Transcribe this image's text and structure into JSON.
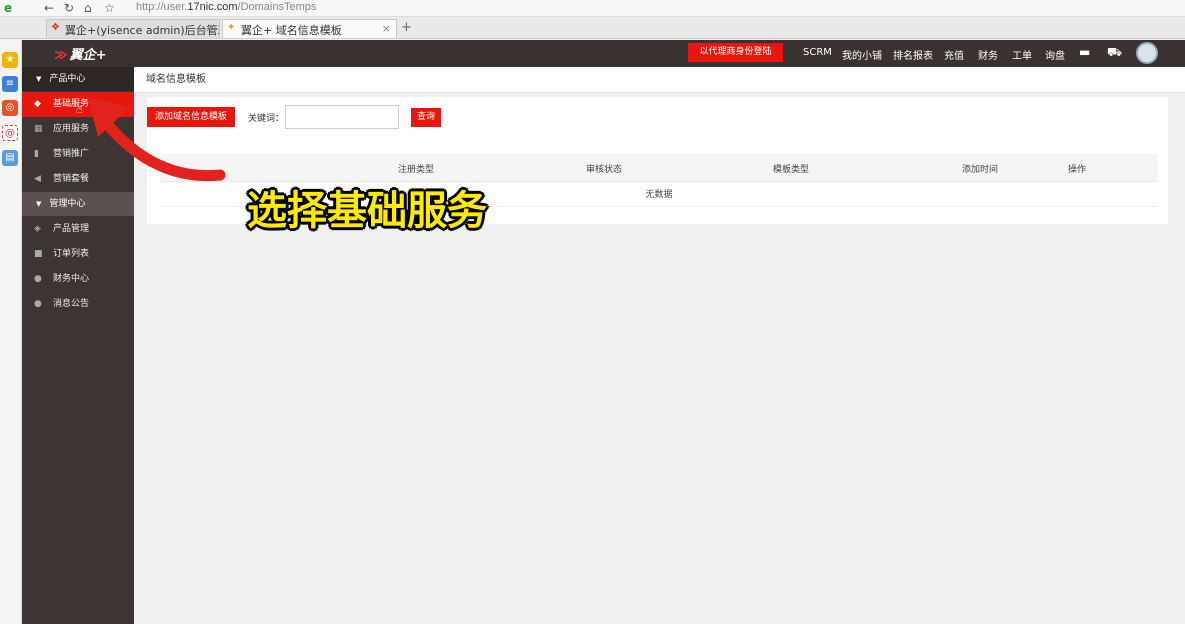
{
  "browser": {
    "url_prefix": "http://user.",
    "url_domain": "17nic.com",
    "url_path": "/DomainsTemps",
    "tabs": [
      {
        "label": "翼企+(yisence admin)后台管理"
      },
      {
        "label": "翼企+ 域名信息模板"
      }
    ],
    "new_tab": "+"
  },
  "topbar": {
    "logo": "翼企+",
    "proxy_button": "以代理商身份登陆",
    "nav": [
      "SCRM",
      "我的小铺",
      "排名报表",
      "充值",
      "财务",
      "工单",
      "询盘"
    ]
  },
  "sidebar": {
    "groups": [
      {
        "label": "产品中心"
      },
      {
        "label": "管理中心"
      }
    ],
    "items_product": [
      {
        "label": "基础服务",
        "icon": "layers-icon"
      },
      {
        "label": "应用服务",
        "icon": "building-icon"
      },
      {
        "label": "营销推广",
        "icon": "chart-icon"
      },
      {
        "label": "营销套餐",
        "icon": "megaphone-icon"
      }
    ],
    "items_manage": [
      {
        "label": "产品管理",
        "icon": "box-icon"
      },
      {
        "label": "订单列表",
        "icon": "lock-icon"
      },
      {
        "label": "财务中心",
        "icon": "money-bag-icon"
      },
      {
        "label": "消息公告",
        "icon": "message-icon"
      }
    ]
  },
  "main": {
    "breadcrumb": "域名信息模板",
    "add_button": "添加域名信息模板",
    "keyword_label": "关键词：",
    "keyword_value": "",
    "search_button": "查询",
    "table": {
      "headers": [
        "注册类型",
        "审核状态",
        "模板类型",
        "添加时间",
        "操作"
      ],
      "empty_text": "无数据"
    }
  },
  "overlay": {
    "caption": "选择基础服务"
  },
  "colors": {
    "accent": "#e8170d",
    "sidebar_bg": "#3d3534",
    "caption": "#ffeb00"
  }
}
